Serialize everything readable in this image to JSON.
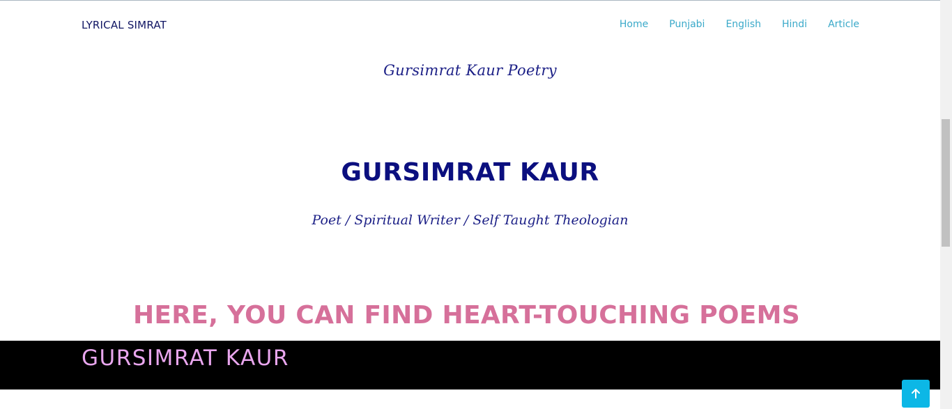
{
  "navbar": {
    "brand": "LYRICAL SIMRAT",
    "links": [
      "Home",
      "Punjabi",
      "English",
      "Hindi",
      "Article"
    ]
  },
  "header": {
    "tagline": "Gursimrat Kaur Poetry"
  },
  "hero": {
    "name": "GURSIMRAT KAUR",
    "roles": "Poet / Spiritual Writer / Self Taught Theologian"
  },
  "section": {
    "headline": "HERE, YOU CAN FIND HEART-TOUCHING POEMS"
  },
  "band": {
    "title": "GURSIMRAT KAUR"
  },
  "icons": {
    "scroll_top": "arrow-up-icon"
  },
  "colors": {
    "brand_text": "#101563",
    "nav_link": "#3aa9c9",
    "hero_name": "#0b0f7f",
    "headline_pink": "#d6709a",
    "band_bg": "#000000",
    "band_text": "#e9a6ee",
    "scroll_top_bg": "#0cb7e6"
  }
}
